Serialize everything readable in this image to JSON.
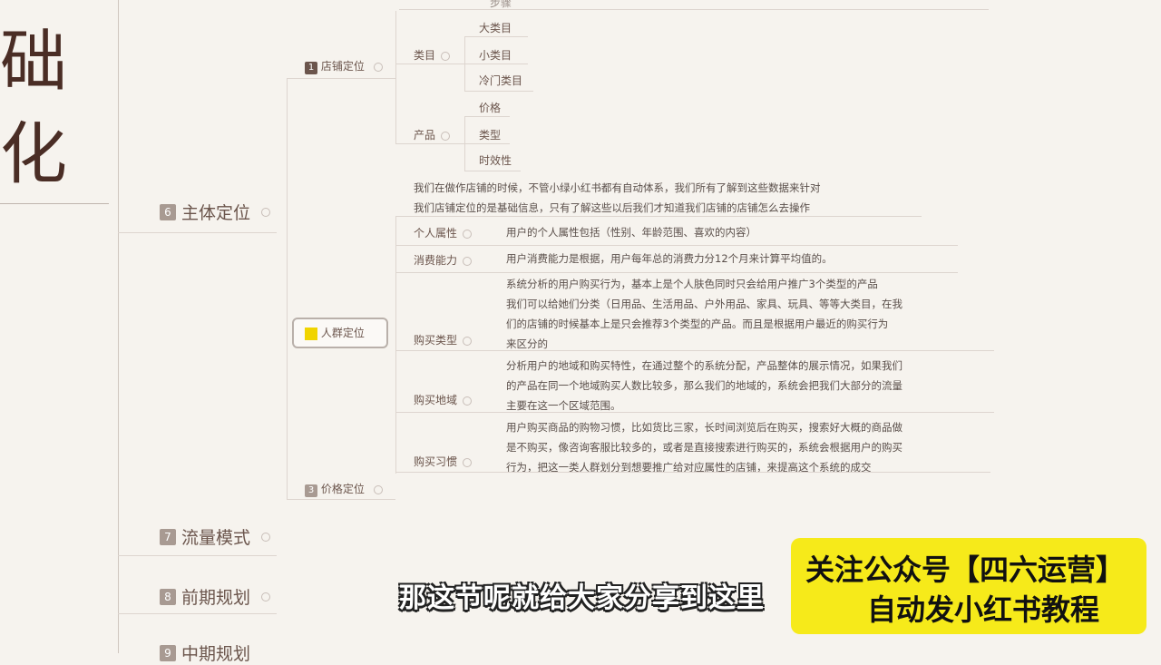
{
  "left_chars": [
    "础",
    "化"
  ],
  "sections": [
    {
      "num": "6",
      "label": "主体定位"
    },
    {
      "num": "7",
      "label": "流量模式"
    },
    {
      "num": "8",
      "label": "前期规划"
    },
    {
      "num": "9",
      "label": "中期规划"
    }
  ],
  "store_branch": {
    "top_label": "步骤",
    "node_num": "1",
    "node_label": "店铺定位",
    "category": {
      "label": "类目",
      "items": [
        "大类目",
        "小类目",
        "冷门类目"
      ]
    },
    "product": {
      "label": "产品",
      "items": [
        "价格",
        "类型",
        "时效性"
      ]
    }
  },
  "intro_text": [
    "我们在做作店铺的时候，不管小绿小红书都有自动体系，我们所有了解到这些数据来针对",
    "我们店铺定位的是基础信息，只有了解这些以后我们才知道我们店铺的店铺怎么去操作"
  ],
  "persona_branch": {
    "node_label": "人群定位",
    "rows": [
      {
        "label": "个人属性",
        "text": [
          "用户的个人属性包括（性别、年龄范围、喜欢的内容）"
        ]
      },
      {
        "label": "消费能力",
        "text": [
          "用户消费能力是根据，用户每年总的消费力分12个月来计算平均值的。"
        ]
      },
      {
        "label": "购买类型",
        "text": [
          "系统分析的用户购买行为，基本上是个人肤色同时只会给用户推广3个类型的产品",
          "我们可以给她们分类（日用品、生活用品、户外用品、家具、玩具、等等大类目，在我",
          "们的店铺的时候基本上是只会推荐3个类型的产品。而且是根据用户最近的购买行为",
          "来区分的"
        ]
      },
      {
        "label": "购买地域",
        "text": [
          "分析用户的地域和购买特性，在通过整个的系统分配，产品整体的展示情况，如果我们",
          "的产品在同一个地域购买人数比较多，那么我们的地域的，系统会把我们大部分的流量",
          "主要在这一个区域范围。"
        ]
      },
      {
        "label": "购买习惯",
        "text": [
          "用户购买商品的购物习惯，比如货比三家，长时间浏览后在购买，搜索好大概的商品做",
          "是不购买，像咨询客服比较多的，或者是直接搜索进行购买的，系统会根据用户的购买",
          "行为，把这一类人群划分到想要推广给对应属性的店铺，来提高这个系统的成交"
        ]
      }
    ]
  },
  "price_node": {
    "num": "3",
    "label": "价格定位"
  },
  "subtitle": "那这节呢就给大家分享到这里",
  "promo": {
    "line1": "关注公众号【四六运营】",
    "line2": "自动发小红书教程"
  },
  "colors": {
    "background": "#f6f3ee",
    "promo_bg": "#f6ea1a",
    "highlight": "#f0d400"
  }
}
